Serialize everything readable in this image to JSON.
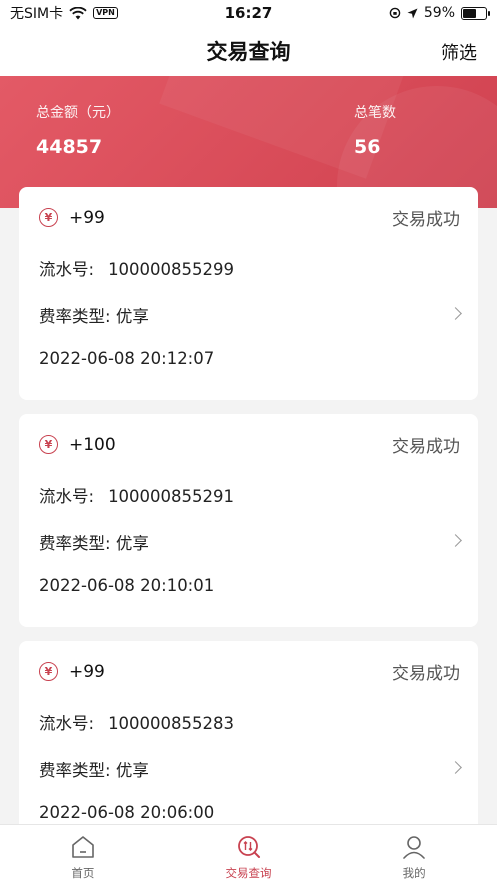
{
  "status_bar": {
    "carrier": "无SIM卡",
    "vpn": "VPN",
    "time": "16:27",
    "battery": "59%",
    "battery_level": 0.59
  },
  "nav": {
    "title": "交易查询",
    "filter": "筛选"
  },
  "summary": {
    "total_amount_label": "总金额（元）",
    "total_amount": "44857",
    "total_count_label": "总笔数",
    "total_count": "56",
    "color": "#d84b58"
  },
  "transactions": [
    {
      "amount": "+99",
      "status": "交易成功",
      "serial_label": "流水号:",
      "serial": "100000855299",
      "rate_label": "费率类型:",
      "rate": "优享",
      "datetime": "2022-06-08 20:12:07"
    },
    {
      "amount": "+100",
      "status": "交易成功",
      "serial_label": "流水号:",
      "serial": "100000855291",
      "rate_label": "费率类型:",
      "rate": "优享",
      "datetime": "2022-06-08 20:10:01"
    },
    {
      "amount": "+99",
      "status": "交易成功",
      "serial_label": "流水号:",
      "serial": "100000855283",
      "rate_label": "费率类型:",
      "rate": "优享",
      "datetime": "2022-06-08 20:06:00"
    }
  ],
  "tabbar": {
    "items": [
      {
        "label": "首页",
        "icon": "home-icon"
      },
      {
        "label": "交易查询",
        "icon": "transaction-icon",
        "active": true
      },
      {
        "label": "我的",
        "icon": "user-icon"
      }
    ],
    "accent": "#c84250"
  }
}
